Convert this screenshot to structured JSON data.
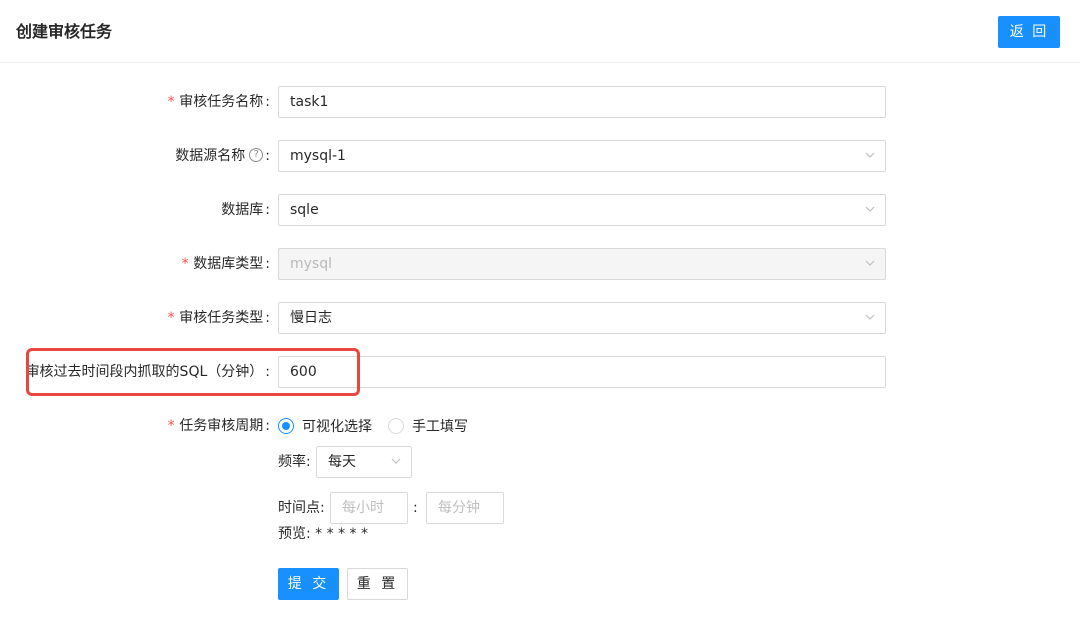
{
  "header": {
    "title": "创建审核任务",
    "back_label": "返 回"
  },
  "form": {
    "task_name": {
      "label": "审核任务名称",
      "required": "*",
      "value": "task1"
    },
    "datasource": {
      "label": "数据源名称",
      "help_icon": "question-circle-icon",
      "help_glyph": "?",
      "value": "mysql-1"
    },
    "database": {
      "label": "数据库",
      "value": "sqle"
    },
    "db_type": {
      "label": "数据库类型",
      "required": "*",
      "value": "mysql"
    },
    "task_type": {
      "label": "审核任务类型",
      "required": "*",
      "value": "慢日志"
    },
    "sql_minutes": {
      "label": "审核过去时间段内抓取的SQL（分钟）",
      "value": "600"
    },
    "cycle": {
      "label": "任务审核周期",
      "required": "*",
      "options": [
        "可视化选择",
        "手工填写"
      ],
      "selected": "可视化选择",
      "frequency_label": "频率:",
      "frequency_value": "每天",
      "time_label": "时间点:",
      "hour_placeholder": "每小时",
      "minute_placeholder": "每分钟",
      "time_separator": ":",
      "preview": "预览: * * * * *"
    },
    "colon": ":"
  },
  "buttons": {
    "submit": "提 交",
    "reset": "重 置"
  },
  "colors": {
    "primary": "#1890ff",
    "required": "#ff4d4f",
    "highlight": "#e8473f"
  }
}
